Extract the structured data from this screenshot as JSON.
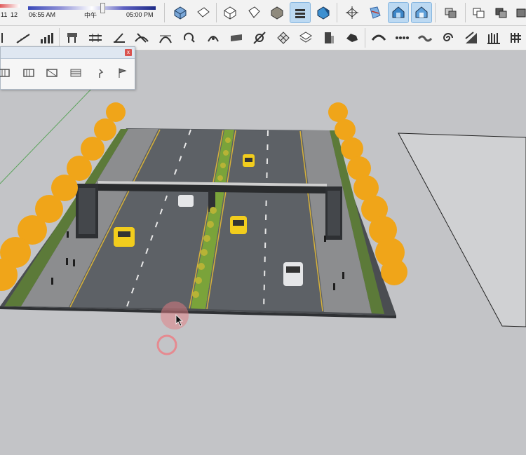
{
  "toolbar_top": {
    "time_left": "06:55 AM",
    "time_mid": "中午",
    "time_right": "05:00 PM",
    "date_left": "11",
    "date_right": "12",
    "buttons": [
      {
        "icon": "iso-view-icon"
      },
      {
        "icon": "top-view-icon"
      },
      {
        "icon": "front-view-icon"
      },
      {
        "icon": "right-view-icon"
      },
      {
        "icon": "back-view-icon"
      },
      {
        "icon": "left-view-icon"
      },
      {
        "icon": "xray-icon"
      },
      {
        "icon": "wireframe-icon"
      },
      {
        "icon": "hidden-line-icon"
      },
      {
        "icon": "shaded-icon"
      },
      {
        "icon": "shaded-textures-icon"
      },
      {
        "icon": "monochrome-icon"
      },
      {
        "icon": "section-plane-icon"
      },
      {
        "icon": "display-section-icon"
      },
      {
        "icon": "outer-shell-icon"
      },
      {
        "icon": "intersect-icon"
      },
      {
        "icon": "union-icon"
      }
    ]
  },
  "toolbar_second": {
    "buttons": [
      {
        "icon": "stairs-icon"
      },
      {
        "icon": "bar-chart-icon"
      },
      {
        "icon": "road-tool-icon"
      },
      {
        "icon": "rail-icon"
      },
      {
        "icon": "split-icon"
      },
      {
        "icon": "branch-icon"
      },
      {
        "icon": "arch-icon"
      },
      {
        "icon": "loop-icon"
      },
      {
        "icon": "curve-icon"
      },
      {
        "icon": "slab-icon"
      },
      {
        "icon": "rotate-icon"
      },
      {
        "icon": "grid-icon"
      },
      {
        "icon": "stack-icon"
      },
      {
        "icon": "door-icon"
      },
      {
        "icon": "paint-icon"
      },
      {
        "icon": "bridge-icon"
      },
      {
        "icon": "dots-icon"
      },
      {
        "icon": "wave-icon"
      },
      {
        "icon": "spiral-icon"
      },
      {
        "icon": "slope-icon"
      },
      {
        "icon": "fence-icon"
      },
      {
        "icon": "grid-small-icon"
      }
    ]
  },
  "tray": {
    "title": "",
    "close_label": "x",
    "tools": [
      {
        "icon": "rail-left-icon"
      },
      {
        "icon": "railing-icon"
      },
      {
        "icon": "fence-panel-icon"
      },
      {
        "icon": "wall-panel-icon"
      },
      {
        "icon": "lamp-icon"
      },
      {
        "icon": "flag-icon"
      }
    ]
  },
  "scene": {
    "description_colors": {
      "road": "#5c6066",
      "sidewalk": "#8b8c8e",
      "grass": "#5e7a3a",
      "tree": "#f0a519",
      "bridge": "#2a2c2e",
      "sky_ground": "#c3c4c7",
      "taxi": "#f2cd1d",
      "car_white": "#e5e6e8"
    }
  }
}
